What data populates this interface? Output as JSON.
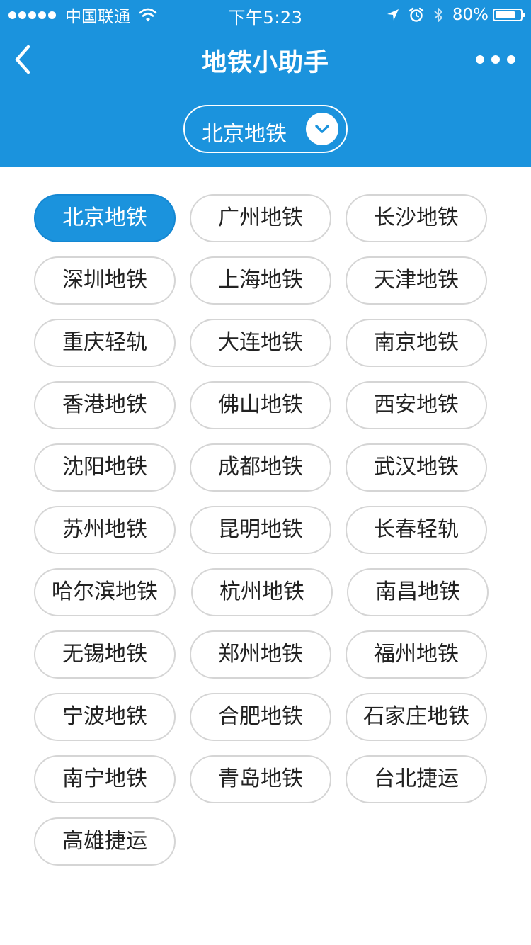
{
  "status_bar": {
    "carrier": "中国联通",
    "time": "下午5:23",
    "battery_percent": "80%",
    "battery_level": 0.8,
    "signal_bars": 5,
    "icons": [
      "wifi-icon",
      "location-arrow-icon",
      "alarm-icon",
      "bluetooth-icon",
      "battery-icon"
    ]
  },
  "nav": {
    "title": "地铁小助手",
    "back_icon": "chevron-left-icon",
    "more_icon": "more-dots-icon"
  },
  "selector": {
    "current": "北京地铁",
    "icon": "chevron-down-icon"
  },
  "cities": [
    {
      "label": "北京地铁",
      "selected": true
    },
    {
      "label": "广州地铁",
      "selected": false
    },
    {
      "label": "长沙地铁",
      "selected": false
    },
    {
      "label": "深圳地铁",
      "selected": false
    },
    {
      "label": "上海地铁",
      "selected": false
    },
    {
      "label": "天津地铁",
      "selected": false
    },
    {
      "label": "重庆轻轨",
      "selected": false
    },
    {
      "label": "大连地铁",
      "selected": false
    },
    {
      "label": "南京地铁",
      "selected": false
    },
    {
      "label": "香港地铁",
      "selected": false
    },
    {
      "label": "佛山地铁",
      "selected": false
    },
    {
      "label": "西安地铁",
      "selected": false
    },
    {
      "label": "沈阳地铁",
      "selected": false
    },
    {
      "label": "成都地铁",
      "selected": false
    },
    {
      "label": "武汉地铁",
      "selected": false
    },
    {
      "label": "苏州地铁",
      "selected": false
    },
    {
      "label": "昆明地铁",
      "selected": false
    },
    {
      "label": "长春轻轨",
      "selected": false
    },
    {
      "label": "哈尔滨地铁",
      "selected": false
    },
    {
      "label": "杭州地铁",
      "selected": false
    },
    {
      "label": "南昌地铁",
      "selected": false
    },
    {
      "label": "无锡地铁",
      "selected": false
    },
    {
      "label": "郑州地铁",
      "selected": false
    },
    {
      "label": "福州地铁",
      "selected": false
    },
    {
      "label": "宁波地铁",
      "selected": false
    },
    {
      "label": "合肥地铁",
      "selected": false
    },
    {
      "label": "石家庄地铁",
      "selected": false
    },
    {
      "label": "南宁地铁",
      "selected": false
    },
    {
      "label": "青岛地铁",
      "selected": false
    },
    {
      "label": "台北捷运",
      "selected": false
    },
    {
      "label": "高雄捷运",
      "selected": false
    }
  ],
  "colors": {
    "brand": "#1b93dd",
    "chip_border": "#d5d5d5",
    "chip_text": "#222222",
    "background": "#ffffff"
  }
}
